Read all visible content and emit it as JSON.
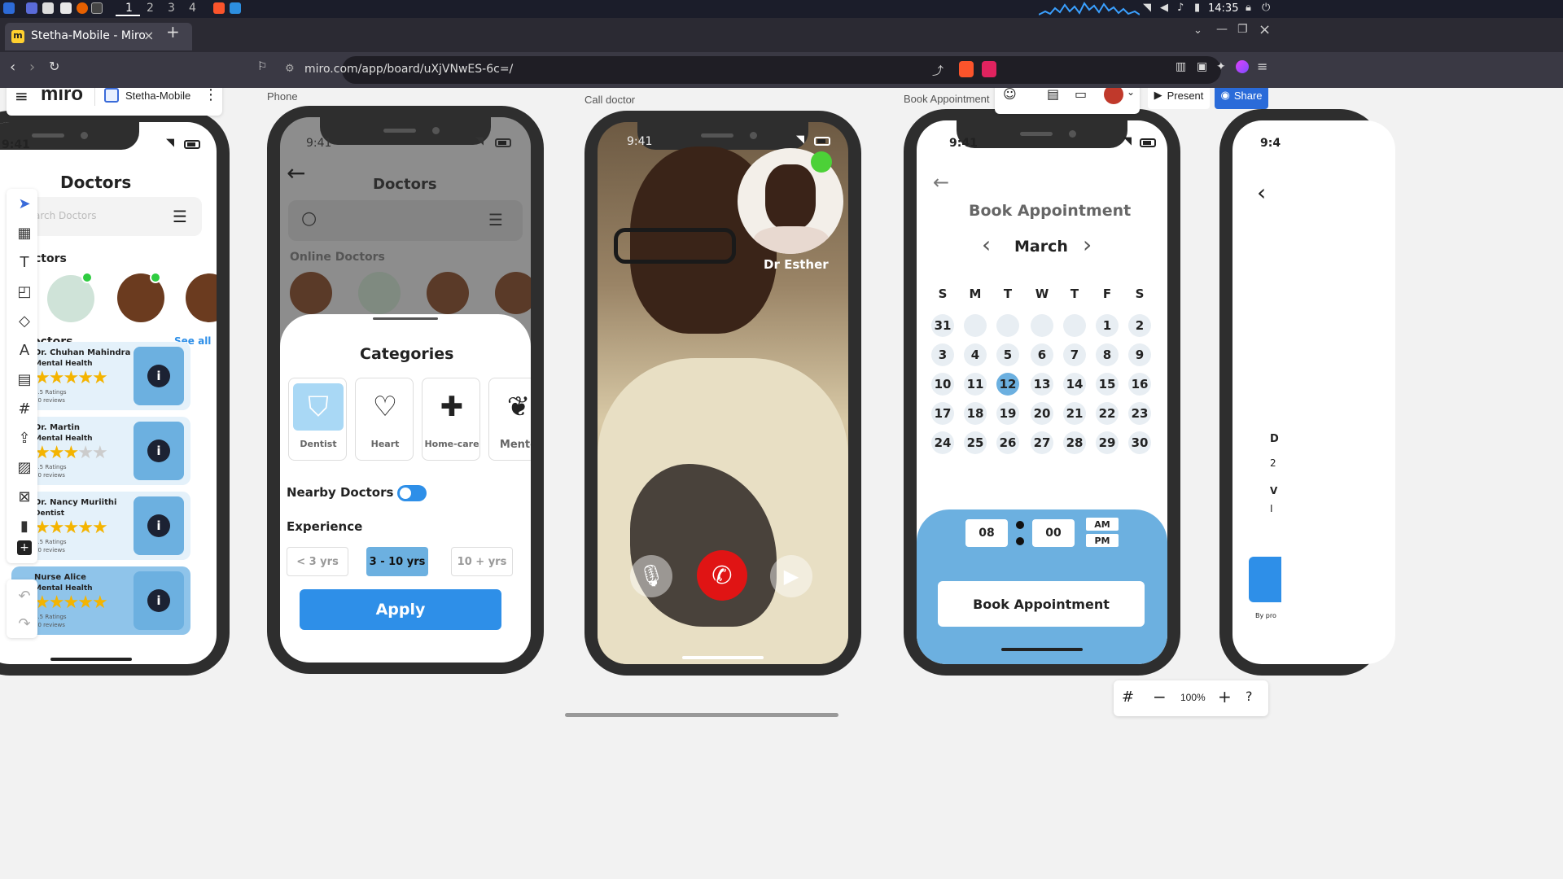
{
  "taskbar": {
    "workspaces": [
      "1",
      "2",
      "3",
      "4"
    ],
    "clock": "14:35"
  },
  "browser": {
    "tab_title": "Stetha-Mobile - Miro",
    "new_tab": "+",
    "url": "miro.com/app/board/uXjVNwES-6c=/"
  },
  "miro": {
    "logo": "miro",
    "board_name": "Stetha-Mobile",
    "present_label": "Present",
    "share_label": "Share",
    "zoom": "100%"
  },
  "frames": {
    "phone_label": "Phone",
    "call_label": "Call doctor",
    "book_label": "Book Appointment"
  },
  "screen1": {
    "time": "9:41",
    "title": "Doctors",
    "search_placeholder": "arch Doctors",
    "online_heading": "ctors",
    "popular_heading": "octors",
    "see_all": "See all",
    "doctors": [
      {
        "name": "Dr. Chuhan Mahindra",
        "specialty": "Mental Health",
        "rating": 5,
        "ratings_text": "4.5 Ratings",
        "reviews": "70 reviews"
      },
      {
        "name": "Dr. Martin",
        "specialty": "Mental Health",
        "rating": 3,
        "ratings_text": "4.5 Ratings",
        "reviews": "70 reviews"
      },
      {
        "name": "Dr. Nancy Muriithi",
        "specialty": "Dentist",
        "rating": 5,
        "ratings_text": "4.5 Ratings",
        "reviews": "70 reviews"
      },
      {
        "name": "Nurse Alice",
        "specialty": "Mental Health",
        "rating": 5,
        "ratings_text": "4.5 Ratings",
        "reviews": "60 reviews"
      }
    ]
  },
  "screen2": {
    "time": "9:41",
    "title": "Doctors",
    "online_heading": "Online Doctors",
    "sheet_title": "Categories",
    "categories": [
      "Dentist",
      "Heart",
      "Home-care",
      "Mento"
    ],
    "nearby_label": "Nearby Doctors",
    "nearby_on": true,
    "experience_label": "Experience",
    "experience_options": [
      "< 3 yrs",
      "3 - 10 yrs",
      "10 + yrs"
    ],
    "experience_selected": "3 - 10 yrs",
    "apply_label": "Apply"
  },
  "screen3": {
    "time": "9:41",
    "doctor_name": "Dr Esther"
  },
  "screen4": {
    "time": "9:41",
    "title": "Book Appointment",
    "month": "March",
    "weekdays": [
      "S",
      "M",
      "T",
      "W",
      "T",
      "F",
      "S"
    ],
    "leading_day": "31",
    "days": [
      "1",
      "2",
      "3",
      "4",
      "5",
      "6",
      "7",
      "8",
      "9",
      "10",
      "11",
      "12",
      "13",
      "14",
      "15",
      "16",
      "17",
      "18",
      "19",
      "20",
      "21",
      "22",
      "23",
      "24",
      "25",
      "26",
      "27",
      "28",
      "29",
      "30"
    ],
    "selected_day": "12",
    "hour": "08",
    "minute": "00",
    "am": "AM",
    "pm": "PM",
    "book_button": "Book Appointment"
  },
  "screen5": {
    "time": "9:4",
    "partial_letters": [
      "D",
      "2",
      "V",
      "I"
    ],
    "footer_text": "By pro"
  },
  "colors": {
    "accent": "#2e8fe8",
    "panel_blue": "#6cb0e0",
    "end_call_red": "#e01414",
    "brand_blue": "#2a6bd9"
  }
}
